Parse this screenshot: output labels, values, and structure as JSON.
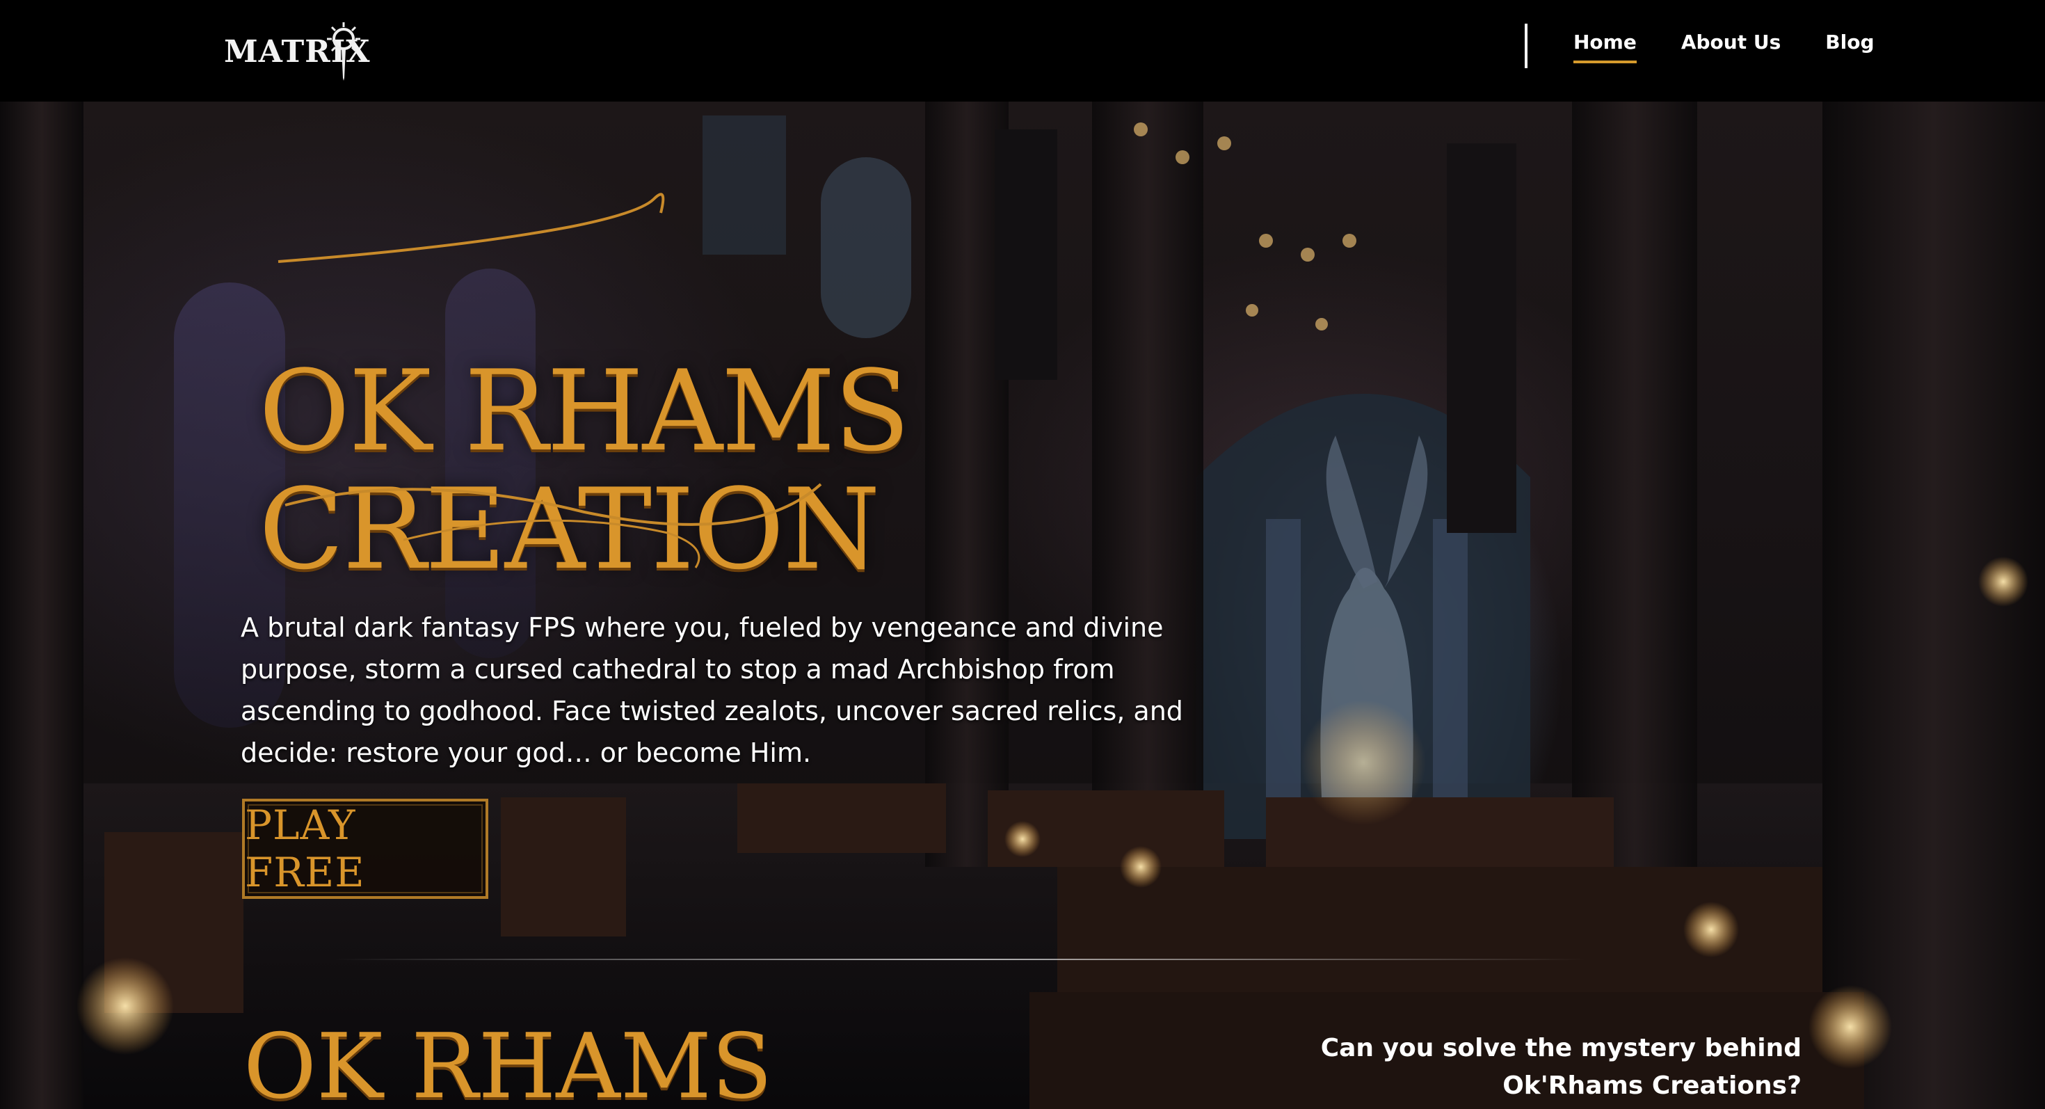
{
  "header": {
    "logo_text": "MATRIX",
    "nav": [
      {
        "label": "Home",
        "active": true
      },
      {
        "label": "About Us",
        "active": false
      },
      {
        "label": "Blog",
        "active": false
      }
    ]
  },
  "hero": {
    "title_line1": "OK RHAMS",
    "title_line2": "CREATION",
    "description": "A brutal dark fantasy FPS where you, fueled by vengeance and divine purpose, storm a cursed cathedral to stop a mad Archbishop from ascending to godhood. Face twisted zealots, uncover sacred relics, and decide: restore your god… or become Him.",
    "cta_label": "PLAY FREE"
  },
  "section2": {
    "title": "OK RHAMS",
    "mystery_line1": "Can you solve the mystery behind",
    "mystery_line2": "Ok'Rhams Creations?"
  },
  "colors": {
    "accent_gold": "#d9952b",
    "nav_underline": "#d59a2c",
    "background": "#000000"
  },
  "icons": {
    "logo_sigil": "sun-dagger-icon"
  }
}
